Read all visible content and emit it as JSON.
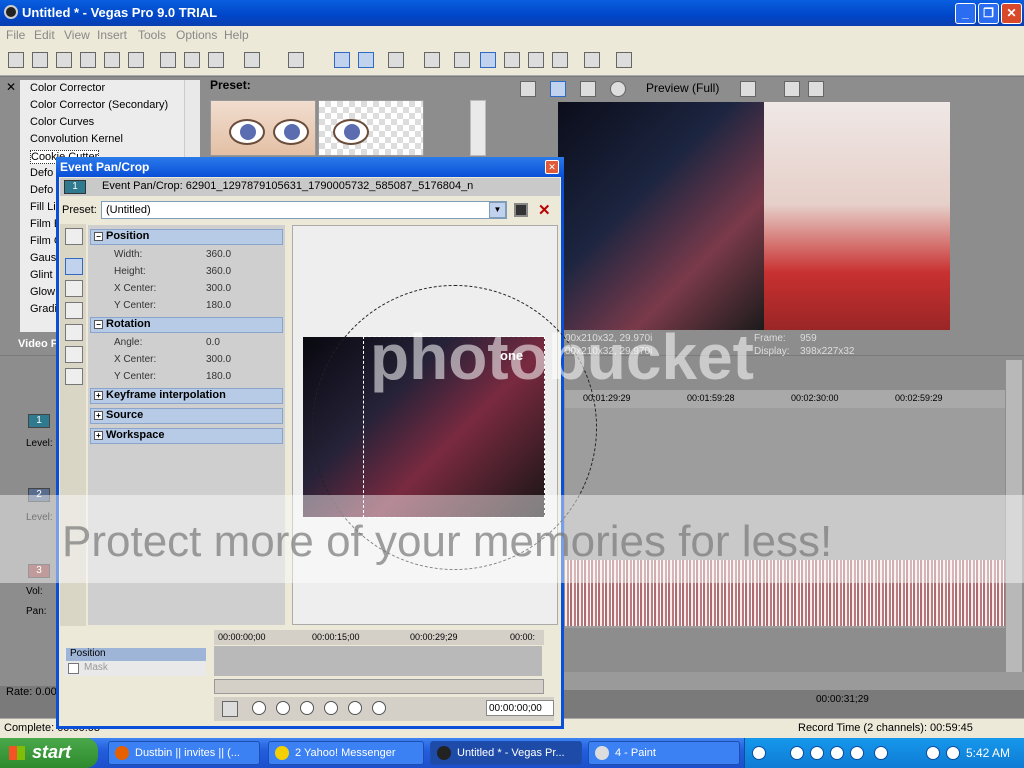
{
  "window": {
    "title": "Untitled * - Vegas Pro 9.0 TRIAL"
  },
  "menu": [
    "File",
    "Edit",
    "View",
    "Insert",
    "Tools",
    "Options",
    "Help"
  ],
  "fx_panel": {
    "items": [
      "Color Corrector",
      "Color Corrector (Secondary)",
      "Color Curves",
      "Convolution Kernel",
      "Cookie Cutter",
      "Defo",
      "Defo",
      "Fill Li",
      "Film E",
      "Film G",
      "Gaus",
      "Glint",
      "Glow",
      "Gradi"
    ],
    "preset_label": "Preset:",
    "tab_label": "Video F"
  },
  "preview": {
    "mode": "Preview (Full)",
    "info_left_1": "00x210x32, 29.970i",
    "info_left_2": "00x210x32, 29.970i",
    "frame_label": "Frame:",
    "frame_value": "959",
    "display_label": "Display:",
    "display_value": "398x227x32"
  },
  "timeline": {
    "ruler": [
      "00:01:29:29",
      "00:01:59:28",
      "00:02:30:00",
      "00:02:59:29"
    ],
    "tracks": [
      {
        "num": "1",
        "label": "Level:"
      },
      {
        "num": "2",
        "label": "Level:"
      },
      {
        "num": "3",
        "label": "Vol:",
        "label2": "Pan:"
      }
    ],
    "rate": "Rate: 0.00",
    "time": "00:00:31;29"
  },
  "status": {
    "complete": "Complete: 00:00:03",
    "record": "Record Time (2 channels): 00:59:45"
  },
  "dialog": {
    "title": "Event Pan/Crop",
    "header_num": "1",
    "header_text": "Event Pan/Crop: 62901_1297879105631_1790005732_585087_5176804_n",
    "preset_label": "Preset:",
    "preset_value": "(Untitled)",
    "sections": {
      "position": "Position",
      "rotation": "Rotation",
      "keyframe": "Keyframe interpolation",
      "source": "Source",
      "workspace": "Workspace"
    },
    "position_rows": [
      {
        "k": "Width:",
        "v": "360.0"
      },
      {
        "k": "Height:",
        "v": "360.0"
      },
      {
        "k": "X Center:",
        "v": "300.0"
      },
      {
        "k": "Y Center:",
        "v": "180.0"
      }
    ],
    "rotation_rows": [
      {
        "k": "Angle:",
        "v": "0.0"
      },
      {
        "k": "X Center:",
        "v": "300.0"
      },
      {
        "k": "Y Center:",
        "v": "180.0"
      }
    ],
    "keyframe_rows": [
      "Position",
      "Mask"
    ],
    "kf_ruler": [
      "00:00:00;00",
      "00:00:15;00",
      "00:00:29;29",
      "00:00:"
    ],
    "kf_time": "00:00:00;00",
    "canvas_logo": "one"
  },
  "taskbar": {
    "start": "start",
    "tasks": [
      "Dustbin || invites || (...",
      "2 Yahoo! Messenger",
      "Untitled * - Vegas Pr...",
      "4 - Paint"
    ],
    "clock": "5:42 AM"
  },
  "watermark": {
    "line1": "photobucket",
    "line2": "Protect more of your memories for less!"
  }
}
